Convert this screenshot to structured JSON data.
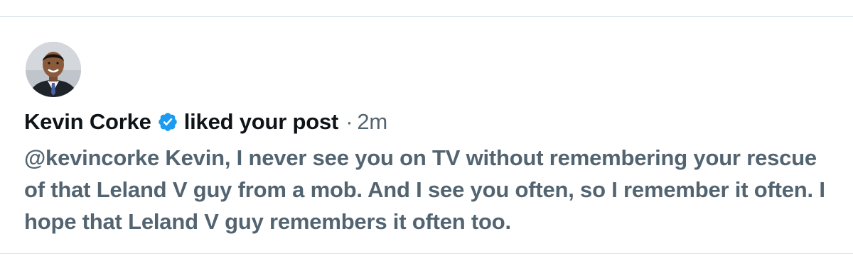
{
  "notification": {
    "user_name": "Kevin Corke",
    "verified_icon": "verified-badge-icon",
    "action_text": "liked your post",
    "separator": "·",
    "time_ago": "2m",
    "post_text": "@kevincorke Kevin, I never see you on TV without remembering your rescue of that Leland V guy from a mob. And I see you often, so I remember it often. I hope that Leland V guy remembers it often too."
  },
  "colors": {
    "primary_text": "#0f1419",
    "secondary_text": "#536471",
    "verified_blue": "#1d9bf0",
    "divider": "#dbe3ea"
  }
}
